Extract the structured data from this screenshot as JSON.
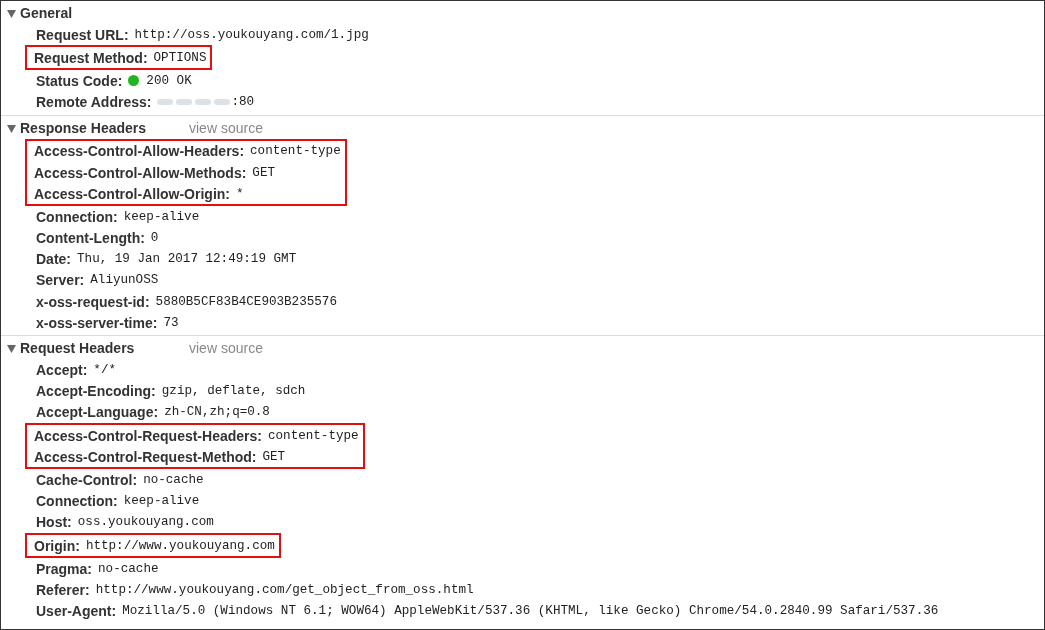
{
  "sections": [
    {
      "title": "General",
      "expanded": true,
      "rows": [
        {
          "name": "Request URL:",
          "value": "http://oss.youkouyang.com/1.jpg",
          "highlighted": false
        },
        {
          "name": "Request Method:",
          "value": "OPTIONS",
          "highlighted": true
        },
        {
          "name": "Status Code:",
          "value": "200 OK",
          "highlighted": false,
          "color": "#22b422"
        },
        {
          "name": "Remote Address:",
          "value": ":80",
          "highlighted": false,
          "kind": "redacted"
        }
      ]
    },
    {
      "title": "Response Headers",
      "link": "view source",
      "expanded": true,
      "rows": [
        {
          "name": "Access-Control-Allow-Headers:",
          "value": "content-type",
          "highlighted": true
        },
        {
          "name": "Access-Control-Allow-Methods:",
          "value": "GET",
          "highlighted": true
        },
        {
          "name": "Access-Control-Allow-Origin:",
          "value": "*",
          "highlighted": true
        },
        {
          "name": "Connection:",
          "value": "keep-alive",
          "highlighted": false
        },
        {
          "name": "Content-Length:",
          "value": "0",
          "highlighted": false
        },
        {
          "name": "Date:",
          "value": "Thu, 19 Jan 2017 12:49:19 GMT",
          "highlighted": false
        },
        {
          "name": "Server:",
          "value": "AliyunOSS",
          "highlighted": false
        },
        {
          "name": "x-oss-request-id:",
          "value": "5880B5CF83B4CE903B235576",
          "highlighted": false
        },
        {
          "name": "x-oss-server-time:",
          "value": "73",
          "highlighted": false
        }
      ]
    },
    {
      "title": "Request Headers",
      "link": "view source",
      "expanded": true,
      "rows": [
        {
          "name": "Accept:",
          "value": "*/*",
          "highlighted": false
        },
        {
          "name": "Accept-Encoding:",
          "value": "gzip, deflate, sdch",
          "highlighted": false
        },
        {
          "name": "Accept-Language:",
          "value": "zh-CN,zh;q=0.8",
          "highlighted": false
        },
        {
          "name": "Access-Control-Request-Headers:",
          "value": "content-type",
          "highlighted": true
        },
        {
          "name": "Access-Control-Request-Method:",
          "value": "GET",
          "highlighted": true
        },
        {
          "name": "Cache-Control:",
          "value": "no-cache",
          "highlighted": false
        },
        {
          "name": "Connection:",
          "value": "keep-alive",
          "highlighted": false
        },
        {
          "name": "Host:",
          "value": "oss.youkouyang.com",
          "highlighted": false
        },
        {
          "name": "Origin:",
          "value": "http://www.youkouyang.com",
          "highlighted": true
        },
        {
          "name": "Pragma:",
          "value": "no-cache",
          "highlighted": false
        },
        {
          "name": "Referer:",
          "value": "http://www.youkouyang.com/get_object_from_oss.html",
          "highlighted": false
        },
        {
          "name": "User-Agent:",
          "value": "Mozilla/5.0 (Windows NT 6.1; WOW64) AppleWebKit/537.36 (KHTML, like Gecko) Chrome/54.0.2840.99 Safari/537.36",
          "highlighted": false
        }
      ]
    }
  ]
}
